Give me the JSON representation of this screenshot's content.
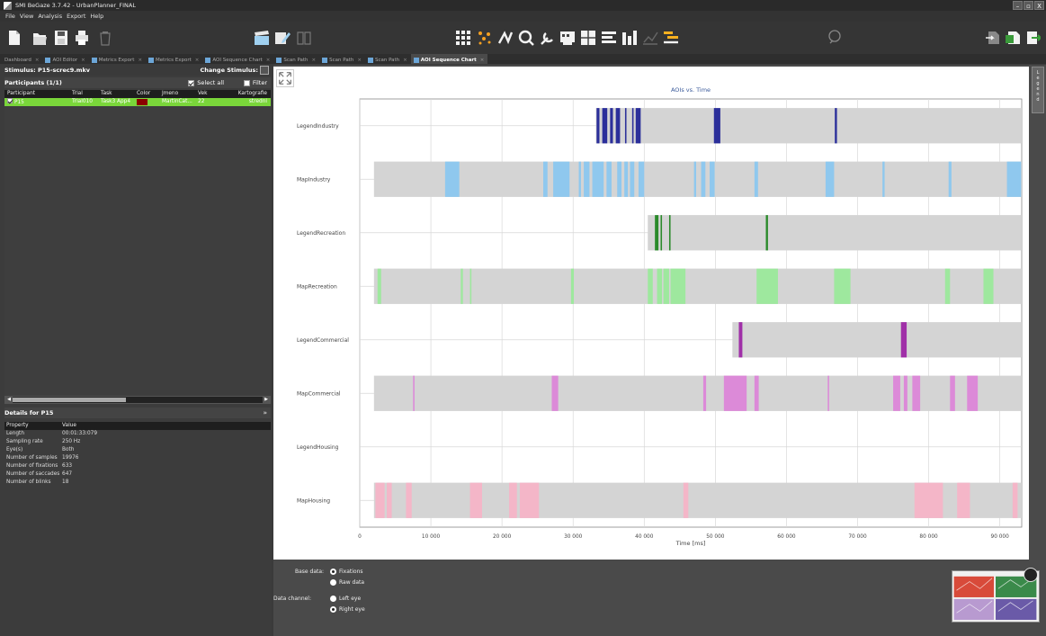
{
  "window": {
    "title": "SMI BeGaze 3.7.42 - UrbanPlanner_FINAL",
    "buttons": [
      "–",
      "▫",
      "X"
    ]
  },
  "menu": [
    "File",
    "View",
    "Analysis",
    "Export",
    "Help"
  ],
  "tabs": [
    {
      "label": "Dashboard",
      "active": false
    },
    {
      "label": "AOI Editor",
      "active": false
    },
    {
      "label": "Metrics Export",
      "active": false
    },
    {
      "label": "Metrics Export",
      "active": false
    },
    {
      "label": "AOI Sequence Chart",
      "active": false
    },
    {
      "label": "Scan Path",
      "active": false
    },
    {
      "label": "Scan Path",
      "active": false
    },
    {
      "label": "Scan Path",
      "active": false
    },
    {
      "label": "AOI Sequence Chart",
      "active": true
    }
  ],
  "left": {
    "stimulus": "Stimulus: P15-screc9.mkv",
    "change_stimulus": "Change Stimulus:",
    "participants_title": "Participants (1/1)",
    "select_all": "Select all",
    "filter": "Filter",
    "columns": [
      "Participant",
      "Trial",
      "Task",
      "Color",
      "Jmeno",
      "Vek",
      "Kartografie"
    ],
    "rows": [
      {
        "participant": "P15",
        "trial": "Trial010",
        "task": "Task3 App4",
        "color": "#8b0000",
        "jmeno": "MartinCat...",
        "vek": "22",
        "kartografie": "stredni"
      }
    ],
    "details_title": "Details for P15",
    "details_columns": [
      "Property",
      "Value"
    ],
    "details": [
      {
        "k": "Length",
        "v": "00:01:33:079"
      },
      {
        "k": "Sampling rate",
        "v": "250 Hz"
      },
      {
        "k": "Eye(s)",
        "v": "Both"
      },
      {
        "k": "Number of samples",
        "v": "19976"
      },
      {
        "k": "Number of fixations",
        "v": "633"
      },
      {
        "k": "Number of saccades",
        "v": "647"
      },
      {
        "k": "Number of blinks",
        "v": "18"
      }
    ]
  },
  "legend_tab": "Legend",
  "bottom": {
    "base_data_label": "Base data:",
    "base_options": [
      {
        "label": "Fixations",
        "on": true
      },
      {
        "label": "Raw data",
        "on": false
      }
    ],
    "channel_label": "Data channel:",
    "channel_options": [
      {
        "label": "Left eye",
        "on": false
      },
      {
        "label": "Right eye",
        "on": true
      }
    ]
  },
  "chart_data": {
    "type": "aoi-sequence",
    "title": "AOIs vs. Time",
    "xlabel": "Time [ms]",
    "xlim": [
      0,
      93079
    ],
    "xticks": [
      0,
      10000,
      20000,
      30000,
      40000,
      50000,
      60000,
      70000,
      80000,
      90000
    ],
    "xtick_labels": [
      "0",
      "10 000",
      "20 000",
      "30 000",
      "40 000",
      "50 000",
      "60 000",
      "70 000",
      "80 000",
      "90 000"
    ],
    "rows": [
      {
        "name": "LegendIndustry",
        "color": "#2b2f9a",
        "active": [
          33200,
          93079
        ],
        "fix": [
          [
            33300,
            33700
          ],
          [
            34100,
            34800
          ],
          [
            35200,
            35600
          ],
          [
            36000,
            36600
          ],
          [
            37300,
            37500
          ],
          [
            38300,
            38500
          ],
          [
            38800,
            39500
          ],
          [
            49800,
            50700
          ],
          [
            66800,
            67100
          ]
        ]
      },
      {
        "name": "MapIndustry",
        "color": "#8fc8ee",
        "active": [
          2000,
          93079
        ],
        "fix": [
          [
            12000,
            14000
          ],
          [
            25800,
            26400
          ],
          [
            27200,
            29500
          ],
          [
            30800,
            31100
          ],
          [
            31500,
            32300
          ],
          [
            32700,
            34300
          ],
          [
            34700,
            35400
          ],
          [
            36200,
            36800
          ],
          [
            37200,
            37700
          ],
          [
            38000,
            38600
          ],
          [
            39200,
            40000
          ],
          [
            47000,
            47300
          ],
          [
            48000,
            48600
          ],
          [
            49200,
            49900
          ],
          [
            55500,
            56000
          ],
          [
            65500,
            66700
          ],
          [
            73500,
            73800
          ],
          [
            82800,
            83200
          ],
          [
            91000,
            93000
          ]
        ]
      },
      {
        "name": "LegendRecreation",
        "color": "#2a8a2a",
        "active": [
          40500,
          93079
        ],
        "fix": [
          [
            41500,
            42000
          ],
          [
            42300,
            42500
          ],
          [
            43500,
            43700
          ],
          [
            57100,
            57400
          ]
        ]
      },
      {
        "name": "MapRecreation",
        "color": "#9ee89e",
        "active": [
          2000,
          93079
        ],
        "fix": [
          [
            2500,
            3000
          ],
          [
            14200,
            14500
          ],
          [
            15500,
            15700
          ],
          [
            29700,
            30100
          ],
          [
            40500,
            41200
          ],
          [
            41800,
            42500
          ],
          [
            42700,
            43500
          ],
          [
            43700,
            45800
          ],
          [
            55800,
            58800
          ],
          [
            66700,
            69000
          ],
          [
            82300,
            83000
          ],
          [
            87700,
            89100
          ]
        ]
      },
      {
        "name": "LegendCommercial",
        "color": "#a030a8",
        "active": [
          52400,
          93079
        ],
        "fix": [
          [
            53300,
            53800
          ],
          [
            76100,
            76900
          ]
        ]
      },
      {
        "name": "MapCommercial",
        "color": "#dc8ad8",
        "active": [
          2000,
          93079
        ],
        "fix": [
          [
            7500,
            7700
          ],
          [
            27000,
            27900
          ],
          [
            48300,
            48700
          ],
          [
            51200,
            54400
          ],
          [
            55500,
            56100
          ],
          [
            65800,
            66000
          ],
          [
            75000,
            76000
          ],
          [
            76500,
            77000
          ],
          [
            77700,
            78800
          ],
          [
            83000,
            83700
          ],
          [
            85400,
            86900
          ]
        ]
      },
      {
        "name": "LegendHousing",
        "color": "#f4b6c8",
        "active": null,
        "fix": []
      },
      {
        "name": "MapHousing",
        "color": "#f4b6c8",
        "active": [
          2000,
          93079
        ],
        "fix": [
          [
            2200,
            3500
          ],
          [
            3800,
            4500
          ],
          [
            6500,
            7300
          ],
          [
            15500,
            17200
          ],
          [
            21000,
            22100
          ],
          [
            22500,
            25200
          ],
          [
            45500,
            46200
          ],
          [
            78000,
            82000
          ],
          [
            84000,
            85800
          ],
          [
            91800,
            92500
          ]
        ]
      }
    ]
  }
}
